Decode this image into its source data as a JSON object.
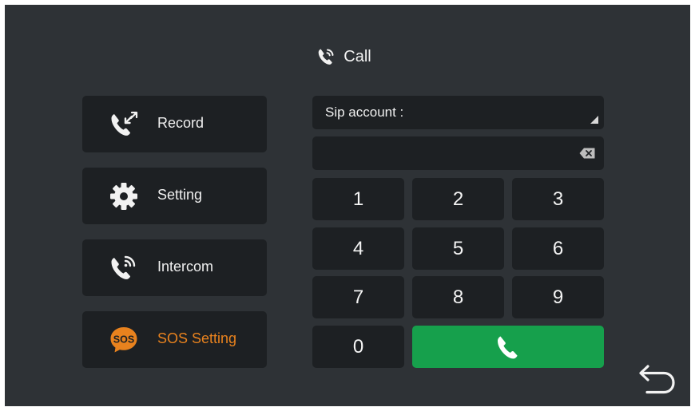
{
  "header": {
    "title": "Call",
    "icon": "phone-ringing-icon"
  },
  "menu": {
    "items": [
      {
        "label": "Record",
        "icon": "call-record-icon",
        "color": "#f0f0f0"
      },
      {
        "label": "Setting",
        "icon": "gear-icon",
        "color": "#f0f0f0"
      },
      {
        "label": "Intercom",
        "icon": "intercom-phone-icon",
        "color": "#f0f0f0"
      },
      {
        "label": "SOS Setting",
        "icon": "sos-icon",
        "color": "#e8821e"
      }
    ]
  },
  "dialer": {
    "sip_label": "Sip account :",
    "number_value": "",
    "keys": [
      "1",
      "2",
      "3",
      "4",
      "5",
      "6",
      "7",
      "8",
      "9",
      "0"
    ],
    "call_icon": "phone-icon",
    "call_color": "#16a04c"
  },
  "navigation": {
    "back_icon": "back-arrow-icon"
  },
  "colors": {
    "background": "#2e3236",
    "button": "#1d2023",
    "accent_orange": "#e8821e",
    "call_green": "#16a04c"
  }
}
